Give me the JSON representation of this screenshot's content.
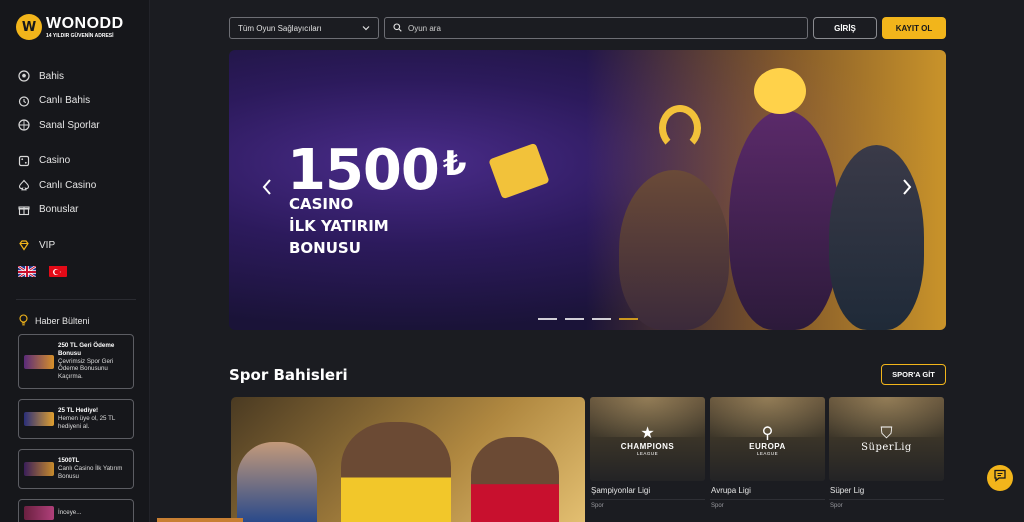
{
  "brand": {
    "name": "WONODD",
    "tagline": "14 YILDIR GÜVENİN ADRESİ",
    "mark": "W"
  },
  "sidebar": {
    "items": [
      {
        "label": "Bahis",
        "icon": "soccer-ball-icon"
      },
      {
        "label": "Canlı Bahis",
        "icon": "stopwatch-icon"
      },
      {
        "label": "Sanal Sporlar",
        "icon": "virtual-sports-icon"
      },
      {
        "label": "Casino",
        "icon": "casino-chip-icon"
      },
      {
        "label": "Canlı Casino",
        "icon": "live-casino-icon"
      },
      {
        "label": "Bonuslar",
        "icon": "gift-icon"
      },
      {
        "label": "VIP",
        "icon": "diamond-icon"
      }
    ],
    "flags": [
      "uk-flag-icon",
      "turkey-flag-icon"
    ],
    "bulletin_label": "Haber Bülteni",
    "promos": [
      {
        "title": "250 TL Geri Ödeme Bonusu",
        "text": "Çevrimsiz Spor Geri Ödeme Bonusunu Kaçırma."
      },
      {
        "title": "25 TL Hediye!",
        "text": "Hemen üye ol, 25 TL hediyeni al."
      },
      {
        "title": "1500TL",
        "text": "Canlı Casino İlk Yatırım Bonusu"
      },
      {
        "title": "",
        "text": "İnceye..."
      }
    ]
  },
  "topbar": {
    "provider_select": "Tüm Oyun Sağlayıcıları",
    "search_placeholder": "Oyun ara",
    "login_label": "GİRİŞ",
    "register_label": "KAYIT OL"
  },
  "banner": {
    "amount": "1500",
    "currency": "₺",
    "line1": "CASINO",
    "line2": "İLK YATIRIM",
    "line3": "BONUSU",
    "slide_count": 4,
    "active_slide": 4
  },
  "sports": {
    "title": "Spor Bahisleri",
    "goto_label": "SPOR'A GİT",
    "leagues": [
      {
        "name": "Şampiyonlar Ligi",
        "category": "Spor",
        "wordmark": "CHAMPIONS",
        "sub": "LEAGUE",
        "logo": "★"
      },
      {
        "name": "Avrupa Ligi",
        "category": "Spor",
        "wordmark": "EUROPA",
        "sub": "LEAGUE",
        "logo": "⚲"
      },
      {
        "name": "Süper Lig",
        "category": "Spor",
        "wordmark": "SüperLig",
        "sub": "",
        "logo": "⛉"
      }
    ]
  },
  "colors": {
    "accent": "#f2b51b",
    "background": "#1b1c21",
    "sidebar": "#16171b"
  }
}
